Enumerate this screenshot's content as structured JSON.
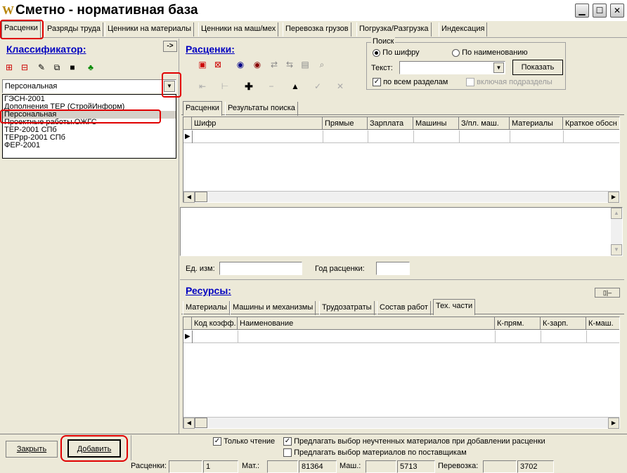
{
  "window": {
    "title": "Сметно - нормативная база"
  },
  "tabs": [
    "Расценки",
    "Разряды труда",
    "Ценники на материалы",
    "Ценники на маш/мех",
    "Перевозка грузов",
    "Погрузка/Разгрузка",
    "Индексация"
  ],
  "left": {
    "header": "Классификатор:",
    "collapse": "->",
    "selected": "Персональная",
    "items": [
      "ГЭСН-2001",
      "Дополнения ТЕР (СтройИнформ)",
      "Персональная",
      "Проектные работы.ОЖГС",
      "ТЕР-2001 СПб",
      "ТЕРрр-2001 СПб",
      "ФЕР-2001"
    ]
  },
  "rates": {
    "header": "Расценки:",
    "subtabs": [
      "Расценки",
      "Результаты поиска"
    ],
    "columns": [
      "Шифр",
      "Прямые",
      "Зарплата",
      "Машины",
      "З/пл. маш.",
      "Материалы",
      "Краткое обосн"
    ]
  },
  "search": {
    "group": "Поиск",
    "by_code": "По шифру",
    "by_name": "По наименованию",
    "text_label": "Текст:",
    "text_value": "",
    "show_button": "Показать",
    "all_sections": "по всем разделам",
    "include_subsections": "включая подразделы"
  },
  "details": {
    "unit_label": "Ед. изм:",
    "unit_value": "",
    "year_label": "Год расценки:",
    "year_value": ""
  },
  "resources": {
    "header": "Ресурсы:",
    "subtabs": [
      "Материалы",
      "Машины и механизмы",
      "Трудозатраты",
      "Состав работ",
      "Тех. части"
    ],
    "columns": [
      "Код коэфф.",
      "Наименование",
      "К-прям.",
      "К-зарп.",
      "К-маш."
    ]
  },
  "footer": {
    "close_button": "Закрыть",
    "add_button": "Добавить",
    "read_only": "Только чтение",
    "offer_unaccounted": "Предлагать выбор неучтенных материалов при добавлении расценки",
    "offer_suppliers": "Предлагать выбор материалов по поставщикам"
  },
  "status": {
    "rates_label": "Расценки:",
    "rates_value": "1",
    "mat_label": "Мат.:",
    "mat_value": "81364",
    "mash_label": "Маш.:",
    "mash_value": "5713",
    "transport_label": "Перевозка:",
    "transport_value": "3702"
  },
  "colors": {
    "header": "#0000c0",
    "highlight": "#e00000"
  }
}
